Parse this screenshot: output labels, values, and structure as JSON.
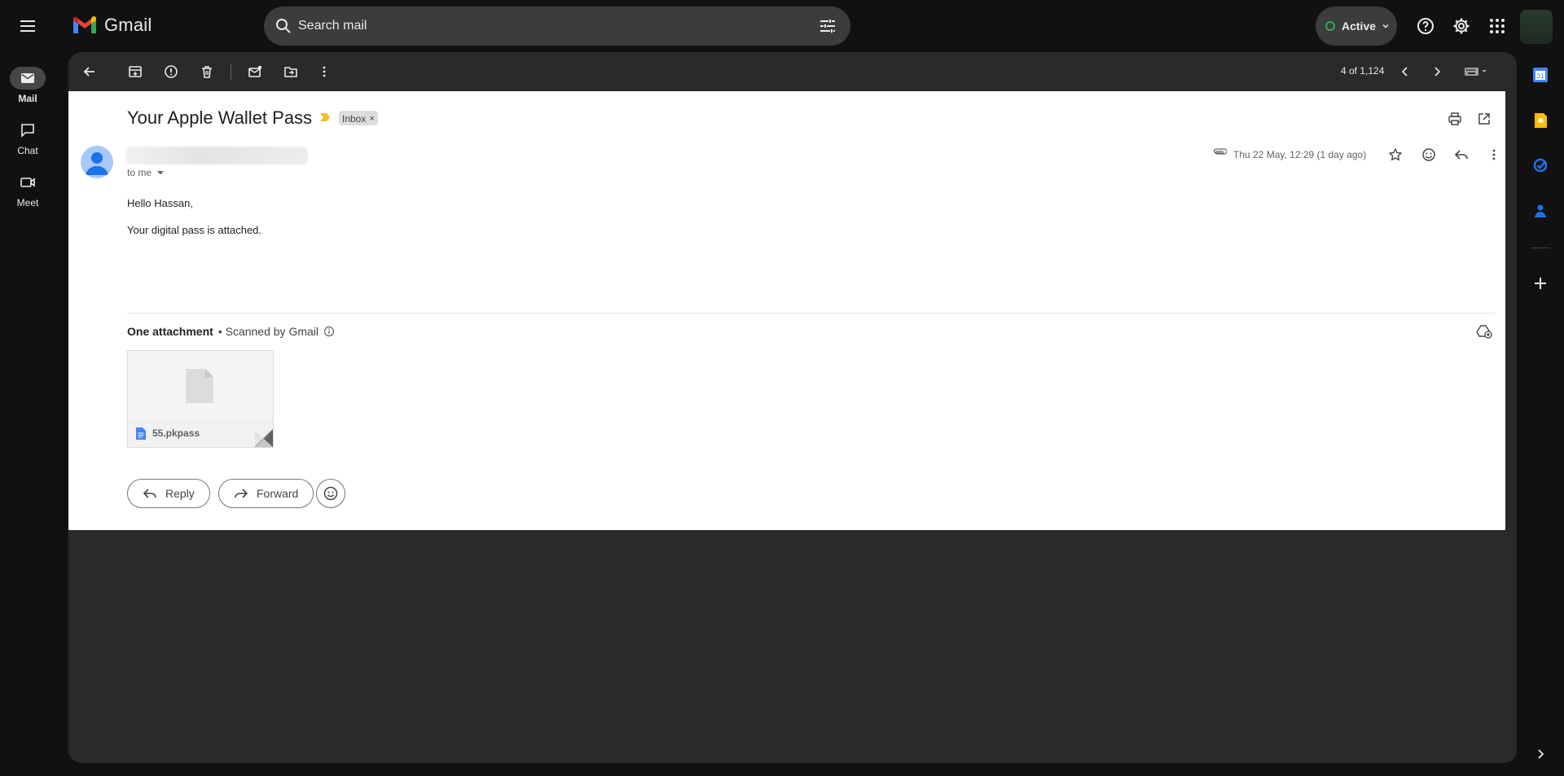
{
  "app": {
    "name": "Gmail"
  },
  "search": {
    "placeholder": "Search mail"
  },
  "status": {
    "label": "Active",
    "color": "#34a853"
  },
  "rail": {
    "items": [
      {
        "label": "Mail",
        "icon": "mail-icon",
        "active": true
      },
      {
        "label": "Chat",
        "icon": "chat-icon",
        "active": false
      },
      {
        "label": "Meet",
        "icon": "meet-icon",
        "active": false
      }
    ]
  },
  "toolbar": {
    "pager": "4 of 1,124"
  },
  "email": {
    "subject": "Your Apple Wallet Pass",
    "label": "Inbox",
    "label_remove": "×",
    "to": "to me",
    "date": "Thu 22 May, 12:29 (1 day ago)",
    "greeting": "Hello Hassan,",
    "body": "Your digital pass is attached."
  },
  "attachments": {
    "title": "One attachment",
    "scanned": "• Scanned by Gmail",
    "files": [
      {
        "name": "55.pkpass",
        "icon": "file-icon"
      }
    ]
  },
  "actions": {
    "reply": "Reply",
    "forward": "Forward"
  },
  "colors": {
    "background": "#111111",
    "panel": "#2a2a2a",
    "email_bg": "#ffffff",
    "important": "#f6bf26"
  }
}
